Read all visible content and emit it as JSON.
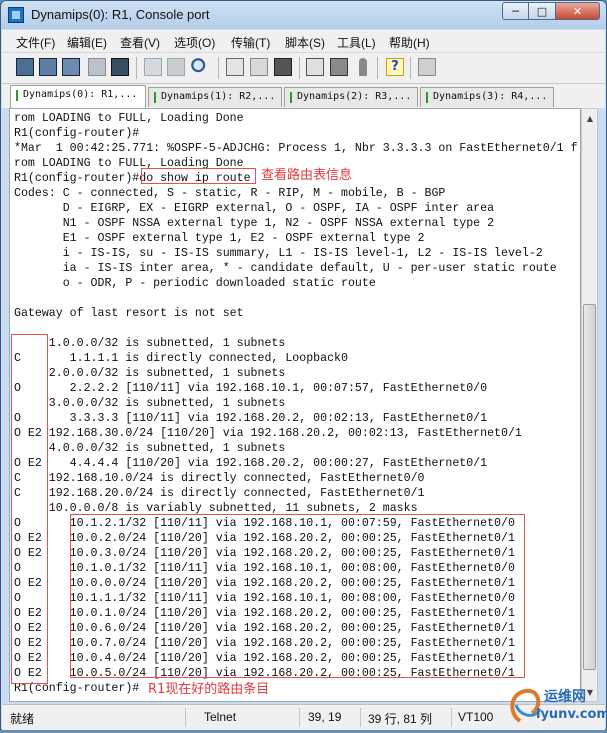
{
  "window": {
    "title": "Dynamips(0): R1, Console port"
  },
  "menu": [
    "文件(F)",
    "编辑(E)",
    "查看(V)",
    "选项(O)",
    "传输(T)",
    "脚本(S)",
    "工具(L)",
    "帮助(H)"
  ],
  "toolbar": [
    "connect-icon",
    "quick-connect-icon",
    "connect-tab-icon",
    "reconnect-icon",
    "disconnect-icon",
    "copy-icon",
    "paste-icon",
    "find-icon",
    "print-setup-icon",
    "print-icon",
    "print-screen-icon",
    "session-options-icon",
    "global-options-icon",
    "keymap-icon",
    "help-icon",
    "lock-icon"
  ],
  "tabs": [
    "Dynamips(0): R1,...",
    "Dynamips(1): R2,...",
    "Dynamips(2): R3,...",
    "Dynamips(3): R4,..."
  ],
  "console_lines": [
    "rom LOADING to FULL, Loading Done",
    "R1(config-router)#",
    "*Mar  1 00:42:25.771: %OSPF-5-ADJCHG: Process 1, Nbr 3.3.3.3 on FastEthernet0/1 f",
    "rom LOADING to FULL, Loading Done",
    "R1(config-router)#do show ip route",
    "Codes: C - connected, S - static, R - RIP, M - mobile, B - BGP",
    "       D - EIGRP, EX - EIGRP external, O - OSPF, IA - OSPF inter area",
    "       N1 - OSPF NSSA external type 1, N2 - OSPF NSSA external type 2",
    "       E1 - OSPF external type 1, E2 - OSPF external type 2",
    "       i - IS-IS, su - IS-IS summary, L1 - IS-IS level-1, L2 - IS-IS level-2",
    "       ia - IS-IS inter area, * - candidate default, U - per-user static route",
    "       o - ODR, P - periodic downloaded static route",
    "",
    "Gateway of last resort is not set",
    "",
    "     1.0.0.0/32 is subnetted, 1 subnets",
    "C       1.1.1.1 is directly connected, Loopback0",
    "     2.0.0.0/32 is subnetted, 1 subnets",
    "O       2.2.2.2 [110/11] via 192.168.10.1, 00:07:57, FastEthernet0/0",
    "     3.0.0.0/32 is subnetted, 1 subnets",
    "O       3.3.3.3 [110/11] via 192.168.20.2, 00:02:13, FastEthernet0/1",
    "O E2 192.168.30.0/24 [110/20] via 192.168.20.2, 00:02:13, FastEthernet0/1",
    "     4.0.0.0/32 is subnetted, 1 subnets",
    "O E2    4.4.4.4 [110/20] via 192.168.20.2, 00:00:27, FastEthernet0/1",
    "C    192.168.10.0/24 is directly connected, FastEthernet0/0",
    "C    192.168.20.0/24 is directly connected, FastEthernet0/1",
    "     10.0.0.0/8 is variably subnetted, 11 subnets, 2 masks",
    "O       10.1.2.1/32 [110/11] via 192.168.10.1, 00:07:59, FastEthernet0/0",
    "O E2    10.0.2.0/24 [110/20] via 192.168.20.2, 00:00:25, FastEthernet0/1",
    "O E2    10.0.3.0/24 [110/20] via 192.168.20.2, 00:00:25, FastEthernet0/1",
    "O       10.1.0.1/32 [110/11] via 192.168.10.1, 00:08:00, FastEthernet0/0",
    "O E2    10.0.0.0/24 [110/20] via 192.168.20.2, 00:00:25, FastEthernet0/1",
    "O       10.1.1.1/32 [110/11] via 192.168.10.1, 00:08:00, FastEthernet0/0",
    "O E2    10.0.1.0/24 [110/20] via 192.168.20.2, 00:00:25, FastEthernet0/1",
    "O E2    10.0.6.0/24 [110/20] via 192.168.20.2, 00:00:25, FastEthernet0/1",
    "O E2    10.0.7.0/24 [110/20] via 192.168.20.2, 00:00:25, FastEthernet0/1",
    "O E2    10.0.4.0/24 [110/20] via 192.168.20.2, 00:00:25, FastEthernet0/1",
    "O E2    10.0.5.0/24 [110/20] via 192.168.20.2, 00:00:25, FastEthernet0/1",
    "R1(config-router)#"
  ],
  "annotations": {
    "show_route": "查看路由表信息",
    "route_count": "R1现在好的路由条目"
  },
  "status": {
    "ready": "就绪",
    "protocol": "Telnet",
    "cursor": "39, 19",
    "size": "39 行, 81 列",
    "terminal": "VT100"
  },
  "watermark": {
    "top": "运维网",
    "bottom": "iyunv.com"
  }
}
